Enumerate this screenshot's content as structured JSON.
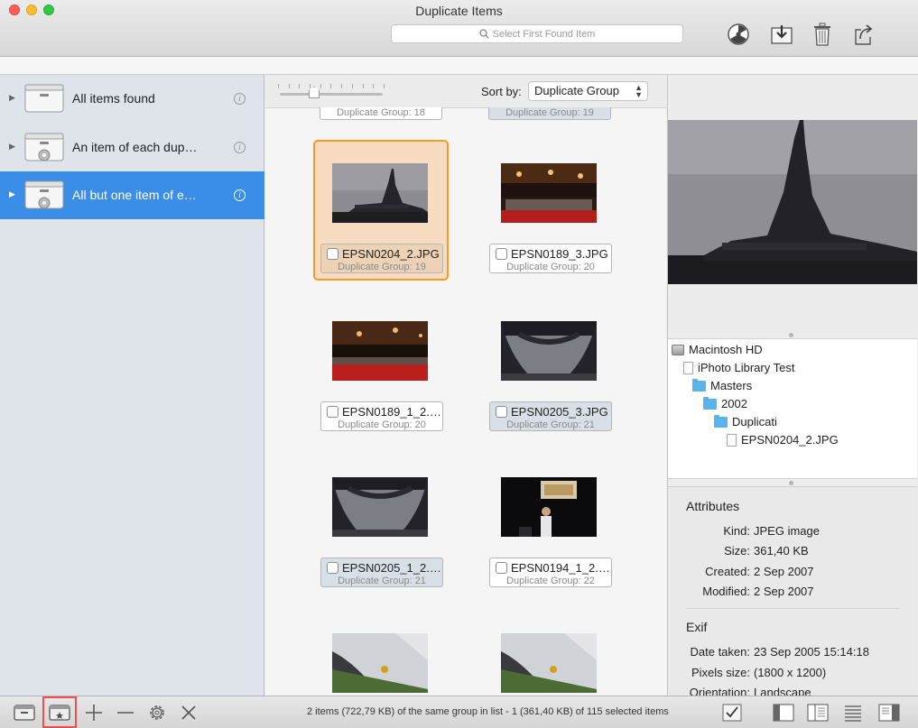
{
  "window": {
    "title": "Duplicate Items"
  },
  "toolbar": {
    "search_placeholder": "Select First Found Item",
    "icons": [
      "radiation-icon",
      "download-box-icon",
      "trash-icon",
      "share-icon"
    ]
  },
  "sidebar": {
    "items": [
      {
        "label": "All items found",
        "selected": false
      },
      {
        "label": "An item of each dup…",
        "selected": false
      },
      {
        "label": "All but one item of e…",
        "selected": true
      }
    ]
  },
  "browser": {
    "sort_label": "Sort by:",
    "sort_value": "Duplicate Group",
    "partial_top": [
      {
        "group": "Duplicate Group: 18"
      },
      {
        "group": "Duplicate Group: 19"
      }
    ],
    "tiles": [
      {
        "file": "EPSN0204_2.JPG",
        "group": "Duplicate Group: 19",
        "selected": true,
        "checked": false
      },
      {
        "file": "EPSN0189_3.JPG",
        "group": "Duplicate Group: 20",
        "selected": false,
        "checked": false
      },
      {
        "file": "EPSN0189_1_2.…",
        "group": "Duplicate Group: 20",
        "selected": false,
        "checked": false
      },
      {
        "file": "EPSN0205_3.JPG",
        "group": "Duplicate Group: 21",
        "selected": false,
        "checked": false
      },
      {
        "file": "EPSN0205_1_2.…",
        "group": "Duplicate Group: 21",
        "selected": false,
        "checked": false
      },
      {
        "file": "EPSN0194_1_2.…",
        "group": "Duplicate Group: 22",
        "selected": false,
        "checked": false
      }
    ]
  },
  "inspector": {
    "path": [
      {
        "label": "Macintosh HD",
        "kind": "disk"
      },
      {
        "label": "iPhoto Library Test",
        "kind": "document"
      },
      {
        "label": "Masters",
        "kind": "folder"
      },
      {
        "label": "2002",
        "kind": "folder"
      },
      {
        "label": "Duplicati",
        "kind": "folder"
      },
      {
        "label": "EPSN0204_2.JPG",
        "kind": "image-file"
      }
    ],
    "attributes_title": "Attributes",
    "attributes": [
      {
        "key": "Kind:",
        "value": "JPEG image"
      },
      {
        "key": "Size:",
        "value": "361,40 KB"
      },
      {
        "key": "Created:",
        "value": "2 Sep 2007"
      },
      {
        "key": "Modified:",
        "value": "2 Sep 2007"
      }
    ],
    "exif_title": "Exif",
    "exif": [
      {
        "key": "Date taken:",
        "value": "23 Sep 2005 15:14:18"
      },
      {
        "key": "Pixels size:",
        "value": "(1800 x 1200)"
      },
      {
        "key": "Orientation:",
        "value": "Landscape"
      }
    ]
  },
  "statusbar": {
    "text": "2 items (722,79 KB) of the same group in list - 1 (361,40 KB) of 115 selected items"
  },
  "colors": {
    "accent": "#3a8ee8",
    "selection_border": "#f59a23",
    "selection_fill": "#f8dcc2",
    "highlight": "#e8514f"
  }
}
